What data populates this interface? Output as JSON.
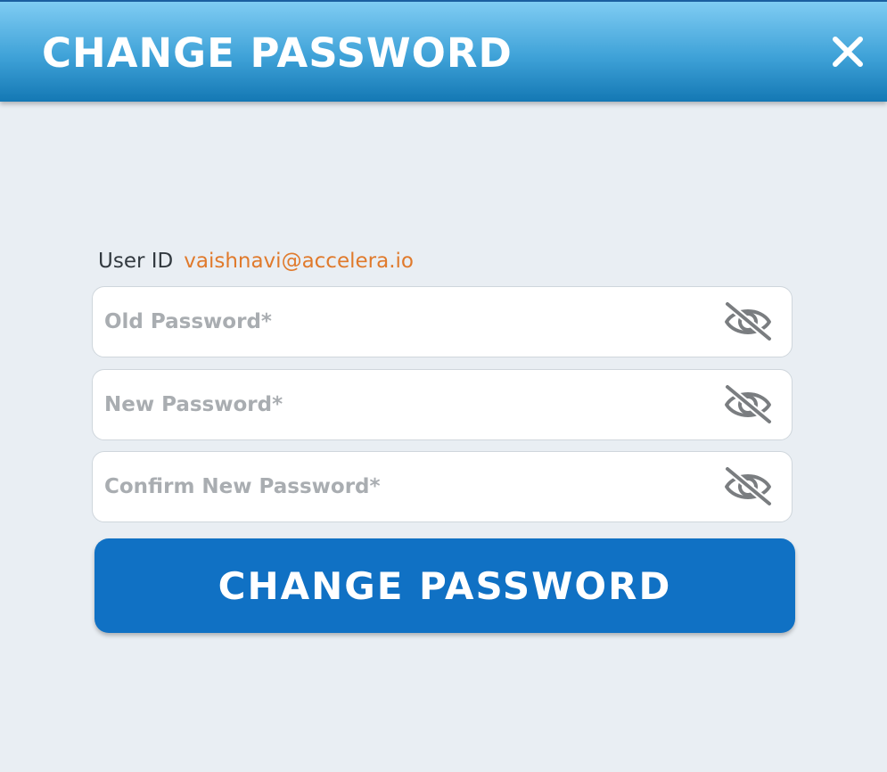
{
  "dialog": {
    "title": "CHANGE PASSWORD",
    "close_icon": "close-icon"
  },
  "user": {
    "label": "User ID",
    "value": "vaishnavi@accelera.io"
  },
  "fields": {
    "old_password": {
      "placeholder": "Old Password*",
      "value": "",
      "visibility_icon": "eye-off-icon"
    },
    "new_password": {
      "placeholder": "New Password*",
      "value": "",
      "visibility_icon": "eye-off-icon"
    },
    "confirm_password": {
      "placeholder": "Confirm New Password*",
      "value": "",
      "visibility_icon": "eye-off-icon"
    }
  },
  "submit": {
    "label": "CHANGE PASSWORD"
  },
  "colors": {
    "header_gradient_top": "#7fccf3",
    "header_gradient_bottom": "#1478b4",
    "background": "#e9eef3",
    "user_id_accent": "#e07a2c",
    "button": "#1071c4",
    "placeholder": "#a9adb1"
  }
}
